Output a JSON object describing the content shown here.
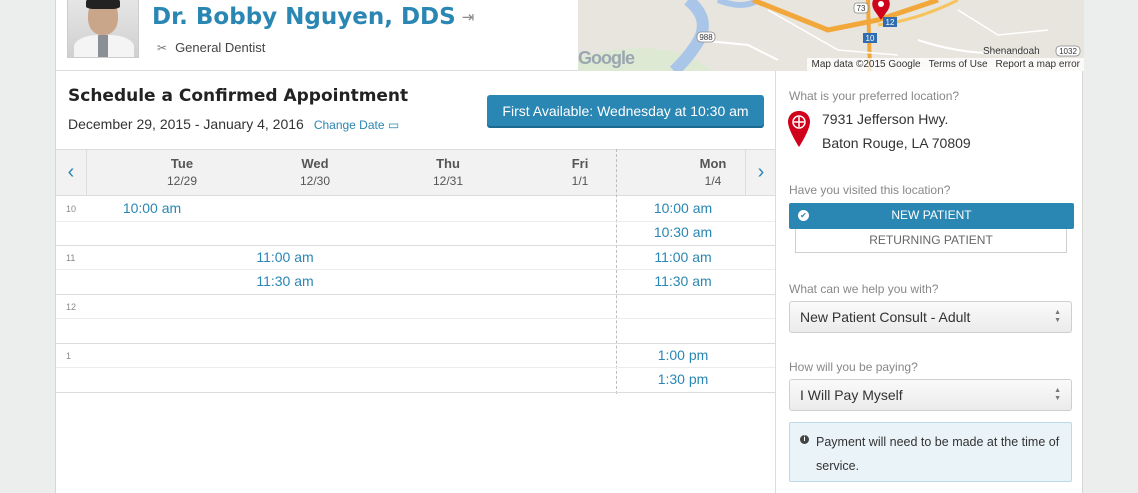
{
  "doctor": {
    "name": "Dr. Bobby Nguyen, DDS",
    "specialty": "General Dentist",
    "photo_icon": "doctor-photo",
    "logout_icon": "sign-out-icon"
  },
  "map": {
    "place_label": "Shenandoah",
    "road_labels": [
      "73",
      "12",
      "10",
      "988",
      "1032"
    ],
    "footer": [
      "Map data ©2015 Google",
      "Terms of Use",
      "Report a map error"
    ],
    "logo": "Google"
  },
  "schedule": {
    "title": "Schedule a Confirmed Appointment",
    "date_range": "December 29, 2015 - January 4, 2016",
    "change_date": "Change Date",
    "first_available": "First Available: Wednesday at 10:30 am",
    "prev_icon": "chevron-left-icon",
    "next_icon": "chevron-right-icon",
    "days": [
      {
        "name": "Tue",
        "date": "12/29"
      },
      {
        "name": "Wed",
        "date": "12/30"
      },
      {
        "name": "Thu",
        "date": "12/31"
      },
      {
        "name": "Fri",
        "date": "1/1"
      },
      {
        "name": "Mon",
        "date": "1/4"
      }
    ],
    "hours": [
      "10",
      "11",
      "12",
      "1"
    ],
    "slots": {
      "tue_1000": "10:00 am",
      "wed_1100": "11:00 am",
      "wed_1130": "11:30 am",
      "mon_1000": "10:00 am",
      "mon_1030": "10:30 am",
      "mon_1100": "11:00 am",
      "mon_1130": "11:30 am",
      "mon_0100": "1:00 pm",
      "mon_0130": "1:30 pm"
    }
  },
  "panel": {
    "location_q": "What is your preferred location?",
    "address_line1": "7931 Jefferson Hwy.",
    "address_line2": "Baton Rouge, LA 70809",
    "visited_q": "Have you visited this location?",
    "new_patient": "NEW PATIENT",
    "returning_patient": "RETURNING PATIENT",
    "help_q": "What can we help you with?",
    "help_value": "New Patient Consult - Adult",
    "paying_q": "How will you be paying?",
    "paying_value": "I Will Pay Myself",
    "info_text": "Payment will need to be made at the time of service."
  },
  "colors": {
    "accent": "#2a86b3",
    "pin": "#d0021b"
  }
}
